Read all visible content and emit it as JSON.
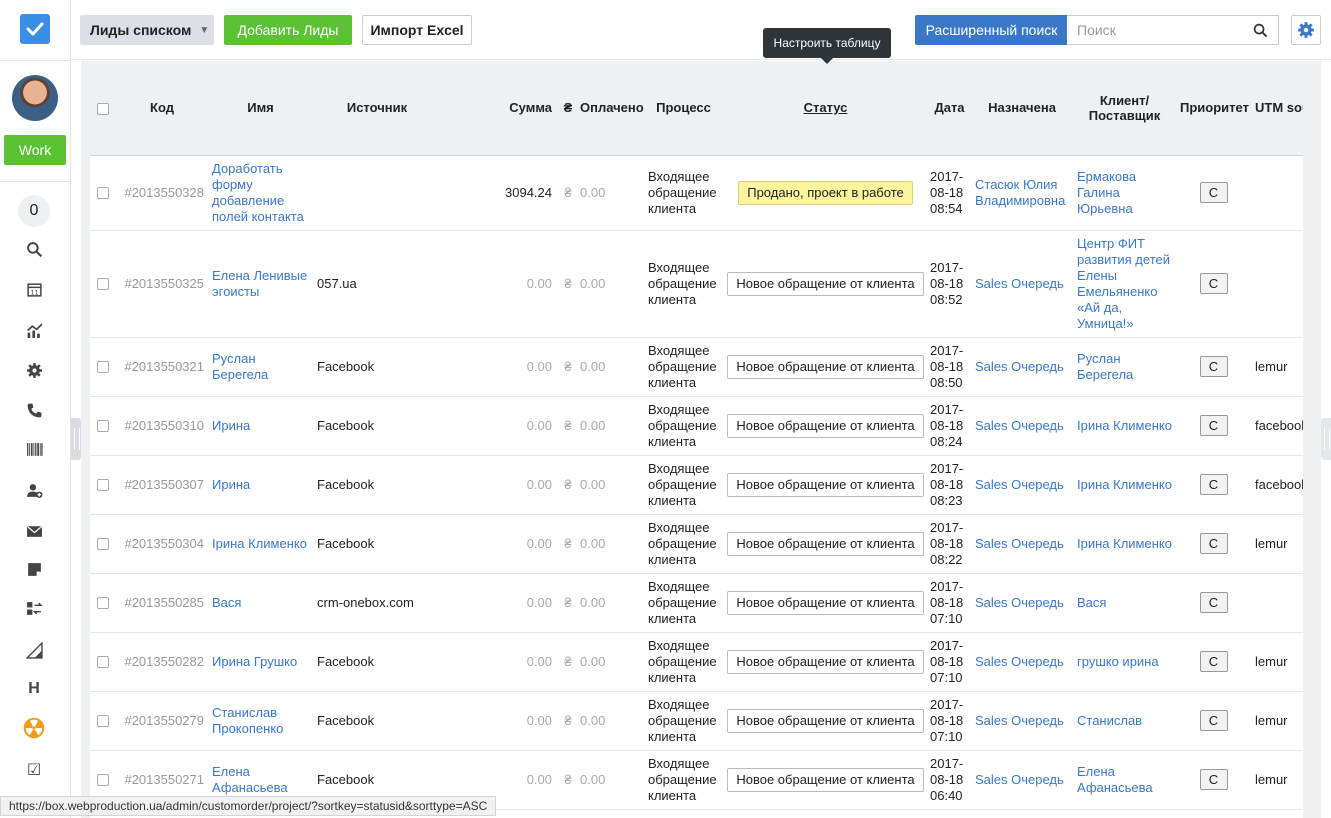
{
  "sidebar": {
    "work_label": "Work",
    "counter": "0",
    "icons": [
      "search-icon",
      "calendar-icon",
      "chart-icon",
      "gear-icon",
      "phone-icon",
      "barcode-icon",
      "add-user-icon",
      "mail-icon",
      "note-icon",
      "transfer-icon",
      "ruler-icon",
      "h-icon",
      "radiation-icon",
      "checkbox-icon"
    ]
  },
  "toolbar": {
    "view_label": "Лиды списком",
    "add_label": "Добавить Лиды",
    "import_label": "Импорт Excel",
    "advanced_search_label": "Расширенный поиск",
    "search_placeholder": "Поиск"
  },
  "tooltip": "Настроить таблицу",
  "table": {
    "headers": {
      "code": "Код",
      "name": "Имя",
      "source": "Источник",
      "sum": "Сумма",
      "currency": "₴",
      "paid": "Оплачено",
      "process": "Процесс",
      "status": "Статус",
      "date": "Дата",
      "assigned": "Назначена",
      "client_l1": "Клиент/",
      "client_l2": "Поставщик",
      "priority": "Приоритет",
      "utm": "UTM source"
    },
    "rows": [
      {
        "code": "#2013550328",
        "name": "Доработать форму добавление полей контакта",
        "source": "",
        "sum": "3094.24",
        "cur": "₴",
        "paid": "0.00",
        "process": "Входящее обращение клиента",
        "status": "Продано, проект в работе",
        "sold": true,
        "date": "2017-08-18 08:54",
        "assigned": "Стасюк Юлия Владимировна",
        "client": "Ермакова Галина Юрьевна",
        "priority": "С",
        "utm": ""
      },
      {
        "code": "#2013550325",
        "name": "Елена Ленивые эгоисты",
        "source": "057.ua",
        "sum": "0.00",
        "cur": "₴",
        "paid": "0.00",
        "process": "Входящее обращение клиента",
        "status": "Новое обращение от клиента",
        "sold": false,
        "date": "2017-08-18 08:52",
        "assigned": "Sales Очередь",
        "client": "Центр ФИТ развития детей Елены Емельяненко «Ай да, Умница!»",
        "priority": "С",
        "utm": ""
      },
      {
        "code": "#2013550321",
        "name": "Руслан Берегела",
        "source": "Facebook",
        "sum": "0.00",
        "cur": "₴",
        "paid": "0.00",
        "process": "Входящее обращение клиента",
        "status": "Новое обращение от клиента",
        "sold": false,
        "date": "2017-08-18 08:50",
        "assigned": "Sales Очередь",
        "client": "Руслан Берегела",
        "priority": "С",
        "utm": "lemur"
      },
      {
        "code": "#2013550310",
        "name": "Ирина",
        "source": "Facebook",
        "sum": "0.00",
        "cur": "₴",
        "paid": "0.00",
        "process": "Входящее обращение клиента",
        "status": "Новое обращение от клиента",
        "sold": false,
        "date": "2017-08-18 08:24",
        "assigned": "Sales Очередь",
        "client": "Ірина Клименко",
        "priority": "С",
        "utm": "facebook"
      },
      {
        "code": "#2013550307",
        "name": "Ирина",
        "source": "Facebook",
        "sum": "0.00",
        "cur": "₴",
        "paid": "0.00",
        "process": "Входящее обращение клиента",
        "status": "Новое обращение от клиента",
        "sold": false,
        "date": "2017-08-18 08:23",
        "assigned": "Sales Очередь",
        "client": "Ірина Клименко",
        "priority": "С",
        "utm": "facebook"
      },
      {
        "code": "#2013550304",
        "name": "Ірина Клименко",
        "source": "Facebook",
        "sum": "0.00",
        "cur": "₴",
        "paid": "0.00",
        "process": "Входящее обращение клиента",
        "status": "Новое обращение от клиента",
        "sold": false,
        "date": "2017-08-18 08:22",
        "assigned": "Sales Очередь",
        "client": "Ірина Клименко",
        "priority": "С",
        "utm": "lemur"
      },
      {
        "code": "#2013550285",
        "name": "Вася",
        "source": "crm-onebox.com",
        "sum": "0.00",
        "cur": "₴",
        "paid": "0.00",
        "process": "Входящее обращение клиента",
        "status": "Новое обращение от клиента",
        "sold": false,
        "date": "2017-08-18 07:10",
        "assigned": "Sales Очередь",
        "client": "Вася",
        "priority": "С",
        "utm": ""
      },
      {
        "code": "#2013550282",
        "name": "Ирина Грушко",
        "source": "Facebook",
        "sum": "0.00",
        "cur": "₴",
        "paid": "0.00",
        "process": "Входящее обращение клиента",
        "status": "Новое обращение от клиента",
        "sold": false,
        "date": "2017-08-18 07:10",
        "assigned": "Sales Очередь",
        "client": "грушко ирина",
        "priority": "С",
        "utm": "lemur"
      },
      {
        "code": "#2013550279",
        "name": "Станислав Прокопенко",
        "source": "Facebook",
        "sum": "0.00",
        "cur": "₴",
        "paid": "0.00",
        "process": "Входящее обращение клиента",
        "status": "Новое обращение от клиента",
        "sold": false,
        "date": "2017-08-18 07:10",
        "assigned": "Sales Очередь",
        "client": "Станислав",
        "priority": "С",
        "utm": "lemur"
      },
      {
        "code": "#2013550271",
        "name": "Елена Афанасьева",
        "source": "Facebook",
        "sum": "0.00",
        "cur": "₴",
        "paid": "0.00",
        "process": "Входящее обращение клиента",
        "status": "Новое обращение от клиента",
        "sold": false,
        "date": "2017-08-18 06:40",
        "assigned": "Sales Очередь",
        "client": "Елена Афанасьева",
        "priority": "С",
        "utm": "lemur"
      }
    ]
  },
  "statusbar_url": "https://box.webproduction.ua/admin/customorder/project/?sortkey=statusid&sorttype=ASC"
}
